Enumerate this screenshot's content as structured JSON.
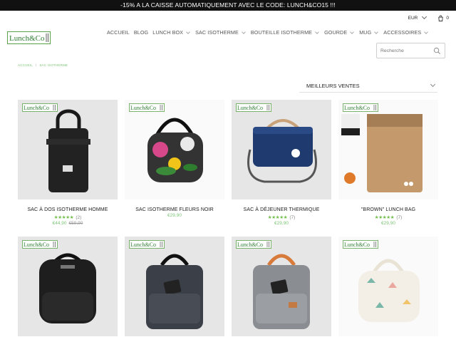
{
  "promo": {
    "text": "-15% A LA CAISSE AUTOMATIQUEMENT AVEC LE CODE: LUNCH&CO15 !!!"
  },
  "header": {
    "currency": "EUR",
    "cart_count": "0",
    "logo_text": "Lunch&Co",
    "search_placeholder": "Recherche"
  },
  "nav": {
    "items": [
      {
        "label": "ACCUEIL",
        "dropdown": false
      },
      {
        "label": "BLOG",
        "dropdown": false
      },
      {
        "label": "LUNCH BOX",
        "dropdown": true
      },
      {
        "label": "SAC ISOTHERME",
        "dropdown": true
      },
      {
        "label": "BOUTEILLE ISOTHERME",
        "dropdown": true
      },
      {
        "label": "GOURDE",
        "dropdown": true
      },
      {
        "label": "MUG",
        "dropdown": true
      },
      {
        "label": "ACCESSOIRES",
        "dropdown": true
      }
    ]
  },
  "breadcrumb": {
    "home": "ACCUEIL",
    "sep": "/",
    "current": "SAC ISOTHERME"
  },
  "sort": {
    "label": "MEILLEURS VENTES"
  },
  "badge_text": "Lunch&Co",
  "colors": {
    "accent_green": "#7cc576",
    "star_green": "#6fbf47",
    "promo_bg": "#111111"
  },
  "products": [
    {
      "name": "SAC À DOS ISOTHERME HOMME",
      "stars": "★★★★★",
      "reviews": "(2)",
      "price": "€44,90",
      "old_price": "€59,90"
    },
    {
      "name": "SAC ISOTHERME FLEURS NOIR",
      "stars": "",
      "reviews": "",
      "price": "€29,90",
      "old_price": ""
    },
    {
      "name": "SAC À DÉJEUNER THERMIQUE",
      "stars": "★★★★★",
      "reviews": "(7)",
      "price": "€29,90",
      "old_price": ""
    },
    {
      "name": "\"BROWN\" LUNCH BAG",
      "stars": "★★★★★",
      "reviews": "(7)",
      "price": "€29,90",
      "old_price": ""
    },
    {
      "name": "",
      "stars": "",
      "reviews": "",
      "price": "",
      "old_price": ""
    },
    {
      "name": "",
      "stars": "",
      "reviews": "",
      "price": "",
      "old_price": ""
    },
    {
      "name": "",
      "stars": "",
      "reviews": "",
      "price": "",
      "old_price": ""
    },
    {
      "name": "",
      "stars": "",
      "reviews": "",
      "price": "",
      "old_price": ""
    }
  ]
}
